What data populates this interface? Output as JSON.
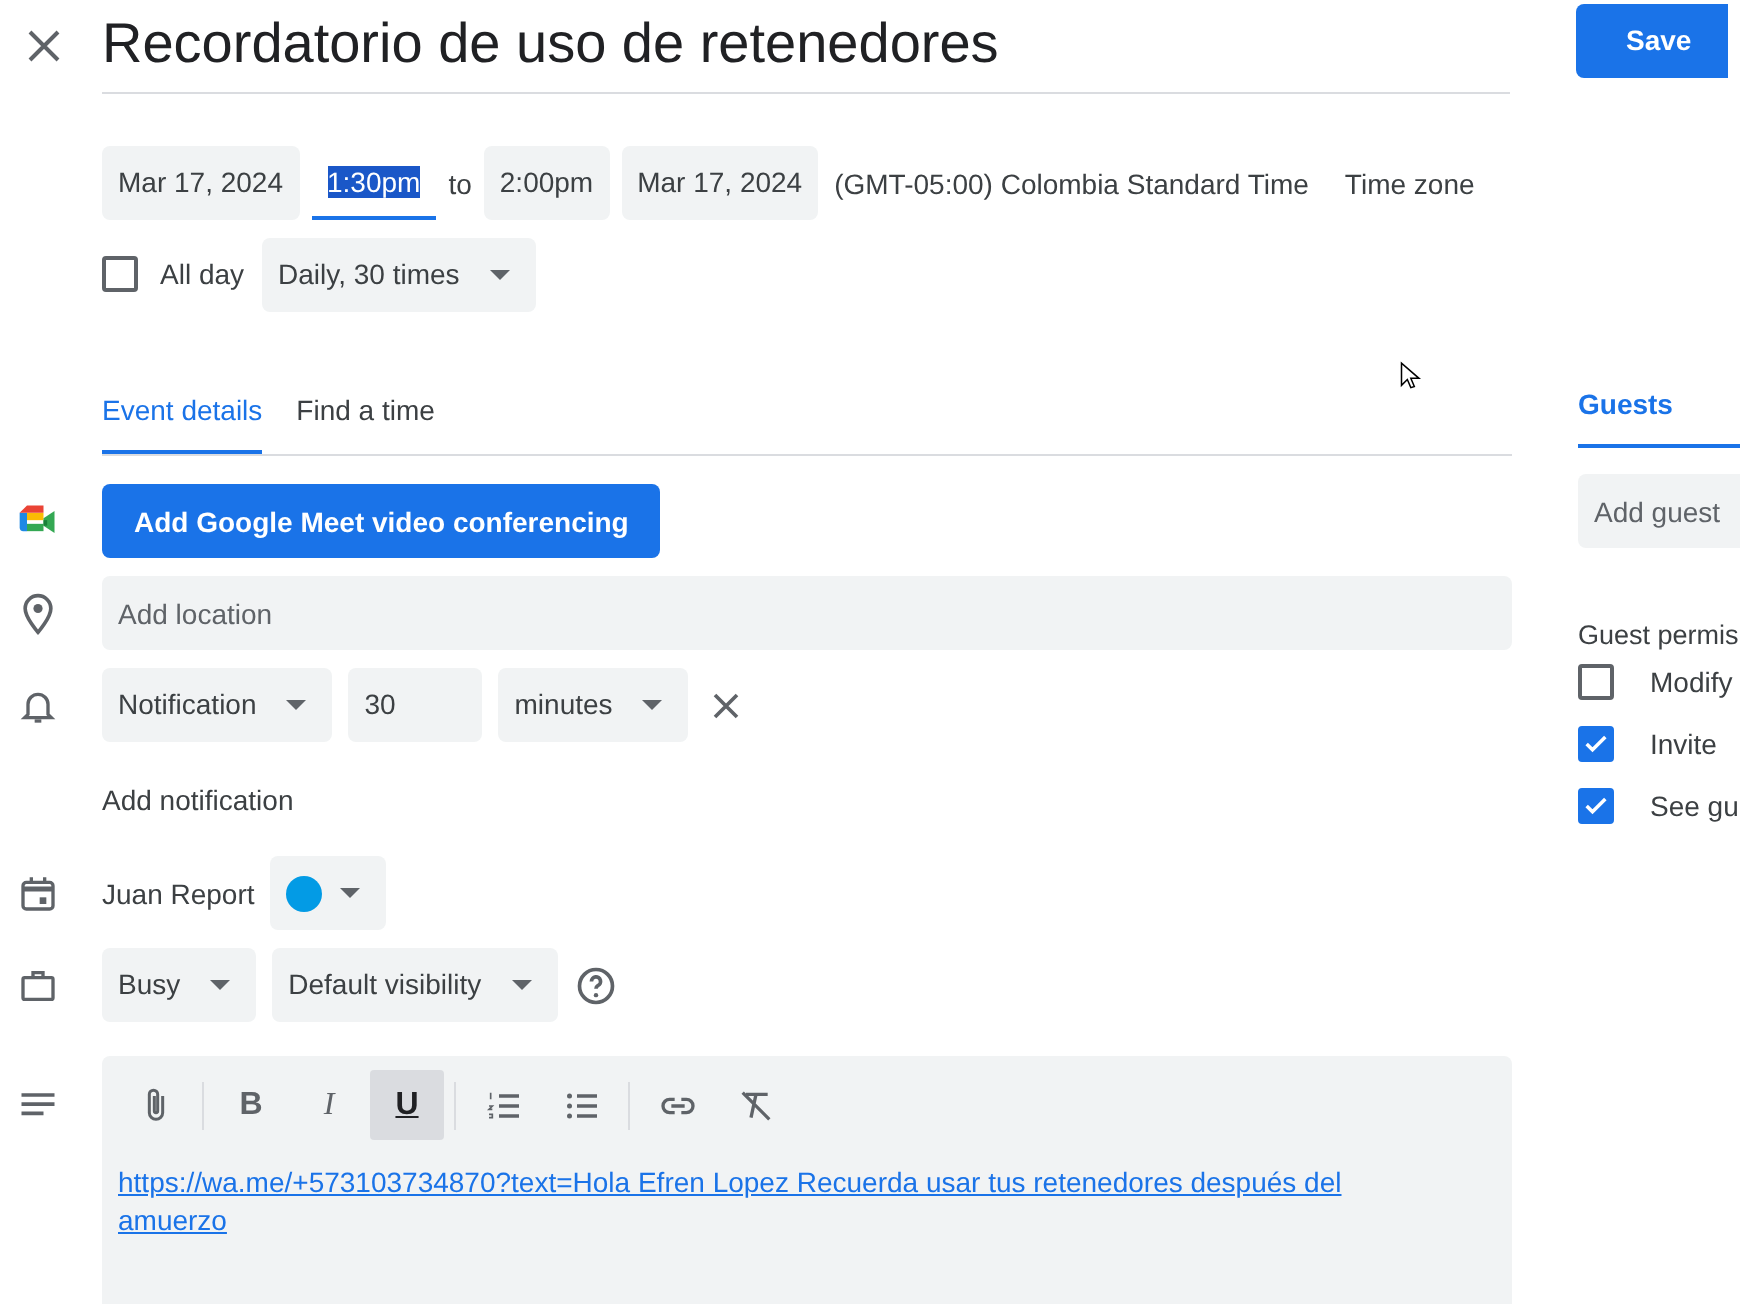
{
  "title": "Recordatorio de uso de retenedores",
  "save_button": "Save",
  "start_date": "Mar 17, 2024",
  "start_time": {
    "value": "1:30pm",
    "focused": true,
    "text_selected": true
  },
  "to_label": "to",
  "end_time": {
    "value": "2:00pm",
    "focused": false,
    "text_selected": false
  },
  "end_date": "Mar 17, 2024",
  "time_zone": "(GMT-05:00) Colombia Standard Time",
  "time_zone_button": "Time zone",
  "all_day": {
    "label": "All day",
    "checked": false
  },
  "recurrence": "Daily, 30 times",
  "tabs": [
    {
      "label": "Event details",
      "selected": true
    },
    {
      "label": "Find a time",
      "selected": false
    }
  ],
  "meet_button": "Add Google Meet video conferencing",
  "location": {
    "placeholder": "Add location"
  },
  "notification": {
    "type": "Notification",
    "amount": "30",
    "unit": "minutes"
  },
  "add_notification": "Add notification",
  "calendar": {
    "name": "Juan Report",
    "color": "#039be5"
  },
  "availability": "Busy",
  "visibility": "Default visibility",
  "description": {
    "toolbar": [
      {
        "kind": "attach",
        "selected": false
      },
      {
        "kind": "divider"
      },
      {
        "kind": "bold",
        "label": "B",
        "selected": false
      },
      {
        "kind": "italic",
        "label": "I",
        "selected": false
      },
      {
        "kind": "underline",
        "label": "U",
        "selected": true
      },
      {
        "kind": "divider"
      },
      {
        "kind": "numbered",
        "selected": false
      },
      {
        "kind": "bulleted",
        "selected": false
      },
      {
        "kind": "divider"
      },
      {
        "kind": "link",
        "selected": false
      },
      {
        "kind": "clear",
        "selected": false
      }
    ],
    "link": "https://wa.me/+573103734870?text=Hola Efren Lopez Recuerda usar tus retenedores después del amuerzo"
  },
  "guests_panel": {
    "tab": {
      "label": "Guests",
      "selected": true
    },
    "add_guests": {
      "placeholder": "Add guest"
    },
    "permissions_title": "Guest permis",
    "permissions": [
      {
        "label": "Modify",
        "checked": false
      },
      {
        "label": "Invite",
        "checked": true
      },
      {
        "label": "See gu",
        "checked": true
      }
    ]
  }
}
